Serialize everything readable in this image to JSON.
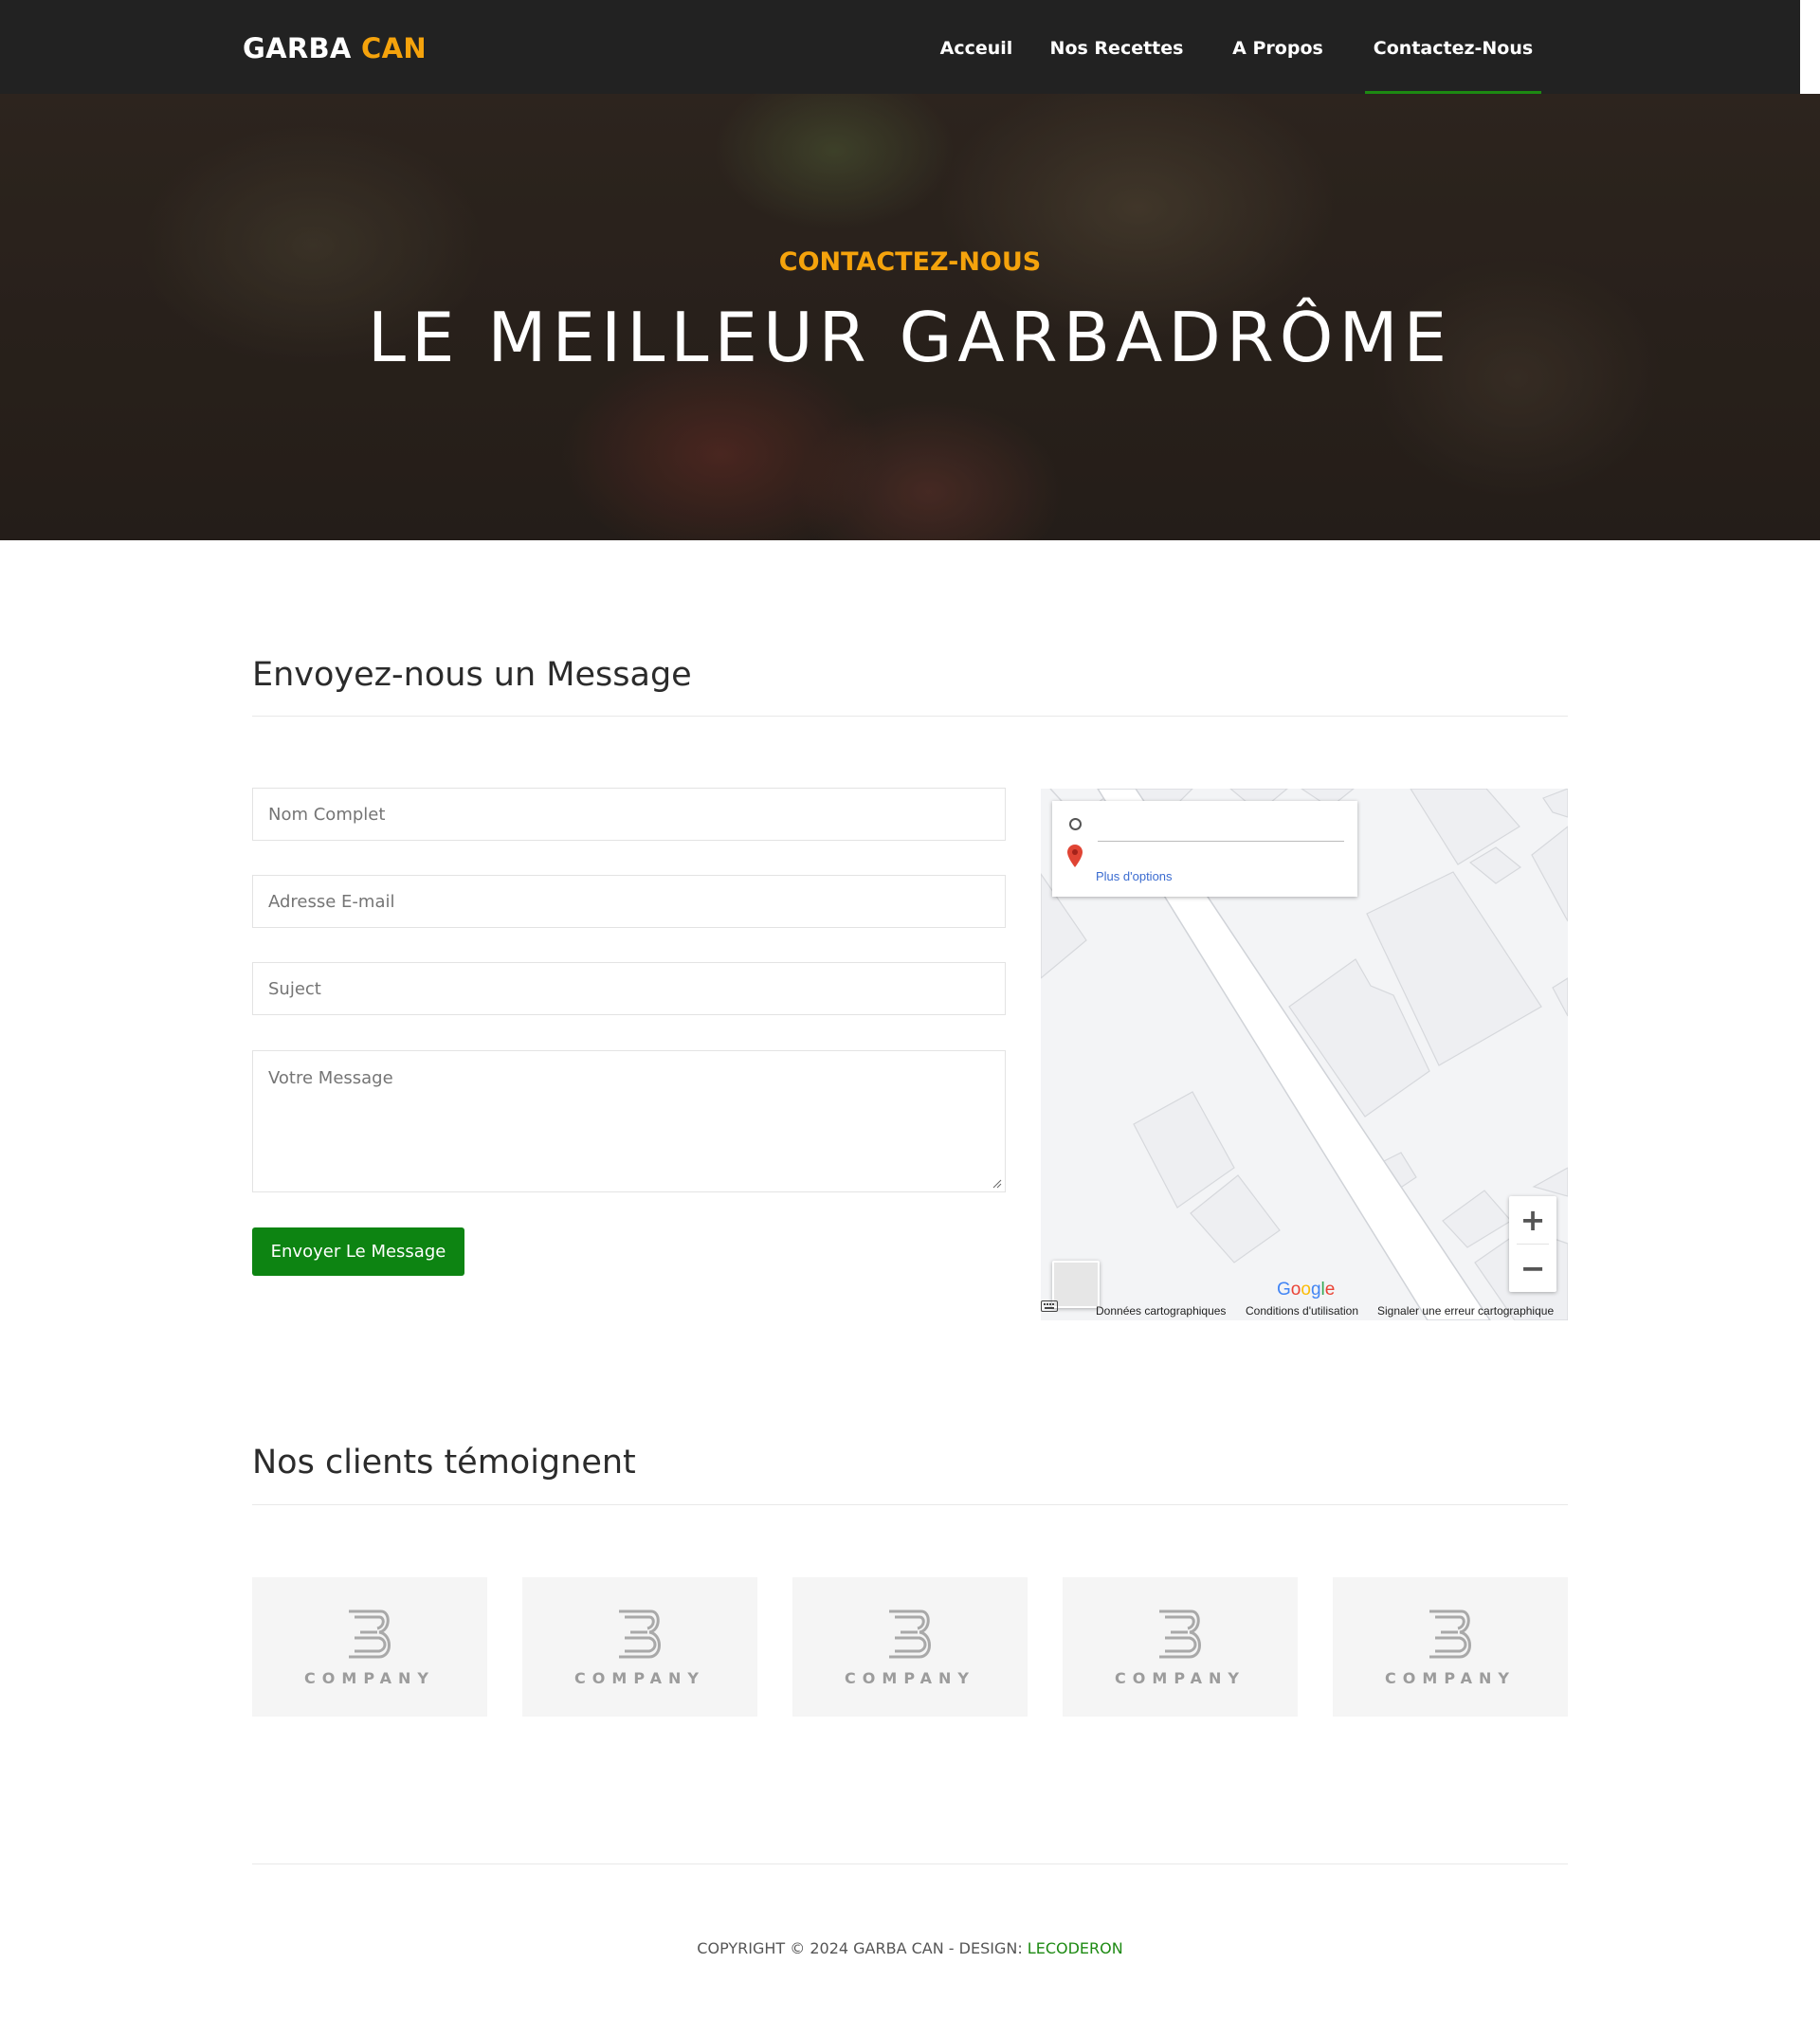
{
  "brand": {
    "part1": "GARBA",
    "part2": "CAN",
    "accent_color": "#f5a30c"
  },
  "nav": {
    "items": [
      {
        "label": "Acceuil"
      },
      {
        "label": "Nos Recettes"
      },
      {
        "label": "A Propos"
      },
      {
        "label": "Contactez-Nous",
        "active": true
      }
    ],
    "active_color": "#1d8a12"
  },
  "hero": {
    "subtitle": "CONTACTEZ-NOUS",
    "title": "LE MEILLEUR GARBADRÔME"
  },
  "contact": {
    "heading": "Envoyez-nous un Message",
    "fields": {
      "name_placeholder": "Nom Complet",
      "email_placeholder": "Adresse E-mail",
      "subject_placeholder": "Suject",
      "message_placeholder": "Votre Message"
    },
    "submit_label": "Envoyer Le Message",
    "submit_color": "#0d8412"
  },
  "map": {
    "more_options": "Plus d'options",
    "zoom_in": "+",
    "zoom_out": "−",
    "logo": "Google",
    "attribution": {
      "data": "Données cartographiques",
      "terms": "Conditions d'utilisation",
      "report": "Signaler une erreur cartographique"
    }
  },
  "clients": {
    "heading": "Nos clients témoignent",
    "logos": [
      {
        "icon": "company-logo-icon",
        "word": "COMPANY"
      },
      {
        "icon": "company-logo-icon",
        "word": "COMPANY"
      },
      {
        "icon": "company-logo-icon",
        "word": "COMPANY"
      },
      {
        "icon": "company-logo-icon",
        "word": "COMPANY"
      },
      {
        "icon": "company-logo-icon",
        "word": "COMPANY"
      }
    ]
  },
  "footer": {
    "copyright": "COPYRIGHT © 2024 GARBA CAN - DESIGN: ",
    "designer": "LECODERON"
  }
}
